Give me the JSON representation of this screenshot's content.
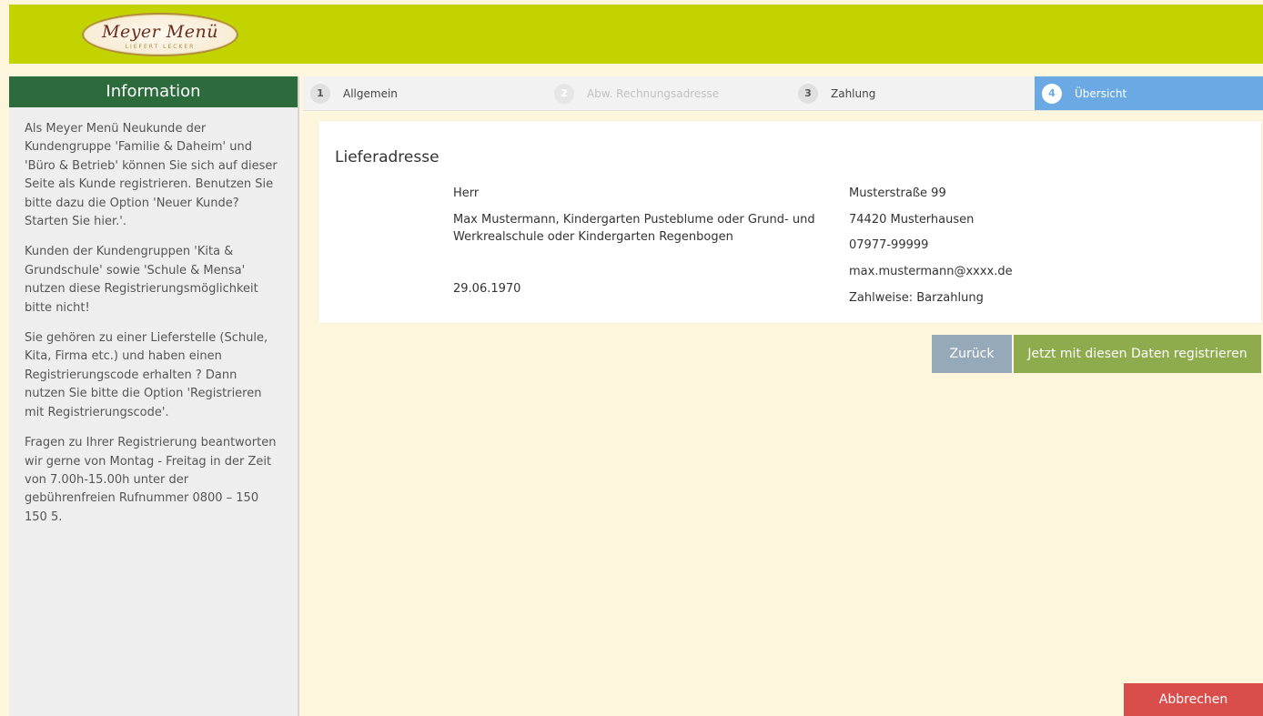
{
  "logo": {
    "script": "Meyer Menü",
    "tagline": "LIEFERT LECKER"
  },
  "sidebar": {
    "title": "Information",
    "paragraphs": [
      "Als Meyer Menü Neukunde der Kundengruppe 'Familie & Daheim' und 'Büro & Betrieb' können Sie sich auf dieser Seite als Kunde registrieren. Benutzen Sie bitte dazu die Option 'Neuer Kunde? Starten Sie hier.'.",
      "Kunden der Kundengruppen 'Kita & Grundschule' sowie 'Schule & Mensa' nutzen diese Registrierungsmöglichkeit bitte nicht!",
      "Sie gehören zu einer Lieferstelle (Schule, Kita, Firma etc.) und haben einen Registrierungscode erhalten ? Dann nutzen Sie bitte die Option 'Registrieren mit Registrierungscode'.",
      "Fragen zu Ihrer Registrierung beantworten wir gerne von Montag - Freitag in der Zeit von 7.00h-15.00h unter der gebührenfreien Rufnummer 0800 – 150 150 5."
    ]
  },
  "steps": [
    {
      "num": "1",
      "label": "Allgemein",
      "state": "done"
    },
    {
      "num": "2",
      "label": "Abw. Rechnungsadresse",
      "state": "disabled"
    },
    {
      "num": "3",
      "label": "Zahlung",
      "state": "done"
    },
    {
      "num": "4",
      "label": "Übersicht",
      "state": "active"
    }
  ],
  "summary": {
    "title": "Lieferadresse",
    "salutation": "Herr",
    "name": "Max Mustermann, Kindergarten Pusteblume oder Grund- und Werkrealschule oder Kindergarten Regenbogen",
    "birthdate": "29.06.1970",
    "street": "Musterstraße 99",
    "city": "74420 Musterhausen",
    "phone": "07977-99999",
    "email": "max.mustermann@xxxx.de",
    "payment": "Zahlweise: Barzahlung"
  },
  "buttons": {
    "back": "Zurück",
    "register": "Jetzt mit diesen Daten registrieren",
    "cancel": "Abbrechen"
  },
  "colors": {
    "header": "#c2d300",
    "sidebar_title": "#2c6b3b",
    "active_step": "#6aa9e3",
    "back_button": "#95a9b9",
    "register_button": "#8eab4d",
    "cancel_button": "#d94d4a"
  }
}
